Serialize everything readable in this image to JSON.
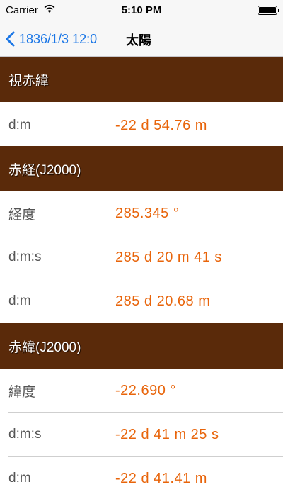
{
  "status_bar": {
    "carrier": "Carrier",
    "time": "5:10 PM"
  },
  "nav": {
    "back_label": "1836/1/3 12:0",
    "title": "太陽"
  },
  "sections": [
    {
      "header": "視赤緯",
      "rows": [
        {
          "label": "d:m",
          "value": "-22 d 54.76 m"
        }
      ]
    },
    {
      "header": "赤経(J2000)",
      "rows": [
        {
          "label": "経度",
          "value": "285.345 °"
        },
        {
          "label": "d:m:s",
          "value": "285 d 20 m 41 s"
        },
        {
          "label": "d:m",
          "value": "285 d 20.68 m"
        }
      ]
    },
    {
      "header": "赤緯(J2000)",
      "rows": [
        {
          "label": "緯度",
          "value": "-22.690 °"
        },
        {
          "label": "d:m:s",
          "value": "-22 d 41 m 25 s"
        },
        {
          "label": "d:m",
          "value": "-22 d 41.41 m"
        }
      ]
    }
  ],
  "colors": {
    "header_bg": "#5a2a0a",
    "value_text": "#e8640a",
    "nav_tint": "#1a76e6"
  }
}
